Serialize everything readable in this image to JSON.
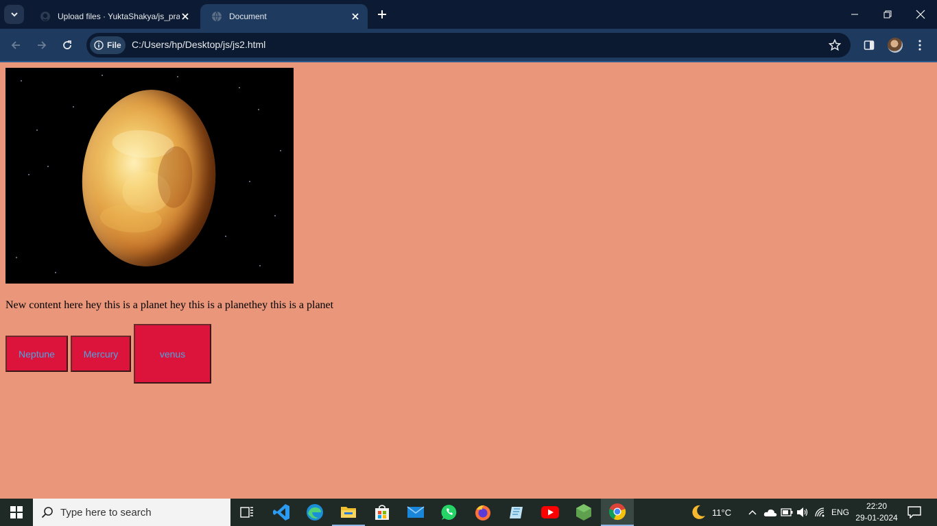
{
  "browser": {
    "tabs": [
      {
        "title": "Upload files · YuktaShakya/js_practice",
        "active": false,
        "icon": "github-icon"
      },
      {
        "title": "Document",
        "active": true,
        "icon": "globe-icon"
      }
    ],
    "address": {
      "scheme_chip": "File",
      "url": "C:/Users/hp/Desktop/js/js2.html"
    }
  },
  "page": {
    "background": "#e9967a",
    "image": {
      "alt": "planet image (Venus)"
    },
    "paragraph": "New content here hey this is a planet hey this is a planethey this is a planet",
    "buttons": [
      {
        "label": "Neptune",
        "bg": "#dc143c",
        "color": "#4fa3e0"
      },
      {
        "label": "Mercury",
        "bg": "#dc143c",
        "color": "#4fa3e0"
      },
      {
        "label": "venus",
        "bg": "#dc143c",
        "color": "#4fa3e0"
      }
    ]
  },
  "taskbar": {
    "search_placeholder": "Type here to search",
    "weather": {
      "temp": "11°C",
      "icon": "moon-icon"
    },
    "language": "ENG",
    "time": "22:20",
    "date": "29-01-2024"
  }
}
